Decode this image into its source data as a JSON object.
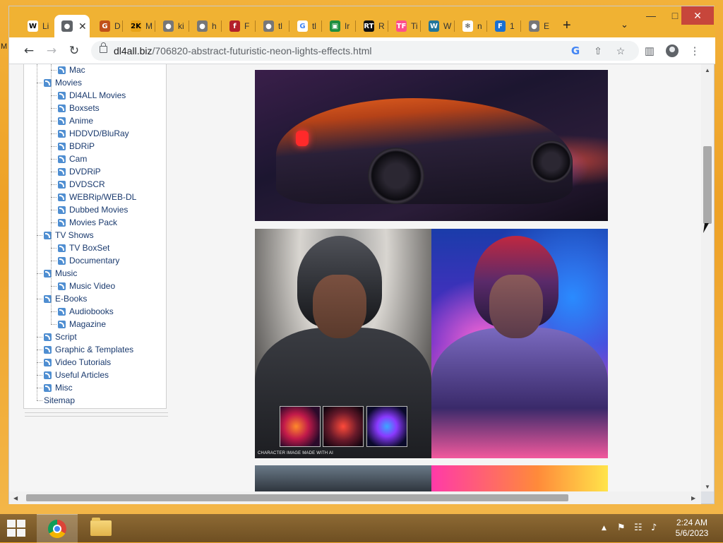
{
  "window": {
    "tabs": [
      {
        "icon": "wikipedia-icon",
        "glyph": "W",
        "color": "#ffffff",
        "fg": "#000000",
        "title": "Li"
      },
      {
        "icon": "globe-icon",
        "glyph": "●",
        "color": "#5f6368",
        "fg": "#ffffff",
        "title": "",
        "active": true
      },
      {
        "icon": "g-square-icon",
        "glyph": "G",
        "color": "#c0501a",
        "fg": "#ffffff",
        "title": "D"
      },
      {
        "icon": "2k-icon",
        "glyph": "2K",
        "color": "#e8a317",
        "fg": "#000000",
        "title": "M"
      },
      {
        "icon": "globe-icon",
        "glyph": "●",
        "color": "#777777",
        "fg": "#ffffff",
        "title": "ki"
      },
      {
        "icon": "globe-icon",
        "glyph": "●",
        "color": "#777777",
        "fg": "#ffffff",
        "title": "h"
      },
      {
        "icon": "f-red-icon",
        "glyph": "f",
        "color": "#b3202a",
        "fg": "#ffffff",
        "title": "F"
      },
      {
        "icon": "globe-icon",
        "glyph": "●",
        "color": "#777777",
        "fg": "#ffffff",
        "title": "tl"
      },
      {
        "icon": "google-icon",
        "glyph": "G",
        "color": "#ffffff",
        "fg": "#4285f4",
        "title": "tl"
      },
      {
        "icon": "image-search-icon",
        "glyph": "▣",
        "color": "#1e8e3e",
        "fg": "#ffffff",
        "title": "Ir"
      },
      {
        "icon": "rt-icon",
        "glyph": "RT",
        "color": "#111111",
        "fg": "#ffffff",
        "title": "R"
      },
      {
        "icon": "tf-icon",
        "glyph": "TF",
        "color": "#ff4f8b",
        "fg": "#ffffff",
        "title": "Ti"
      },
      {
        "icon": "wordpress-icon",
        "glyph": "W",
        "color": "#21759b",
        "fg": "#ffffff",
        "title": "W"
      },
      {
        "icon": "snowflake-icon",
        "glyph": "❄",
        "color": "#ffffff",
        "fg": "#444444",
        "title": "n"
      },
      {
        "icon": "f-blue-icon",
        "glyph": "F",
        "color": "#1a6fd1",
        "fg": "#ffffff",
        "title": "1"
      },
      {
        "icon": "globe-icon",
        "glyph": "●",
        "color": "#777777",
        "fg": "#ffffff",
        "title": "E"
      }
    ],
    "new_tab": "+",
    "tab_list": "⌄",
    "controls": {
      "minimize": "—",
      "maximize": "□",
      "close": "✕"
    }
  },
  "toolbar": {
    "back": "←",
    "forward": "→",
    "reload": "↻",
    "url_host": "dl4all.biz",
    "url_path": "/706820-abstract-futuristic-neon-lights-effects.html",
    "google_lens": "G",
    "share": "⇧",
    "bookmark": "☆",
    "side_panel": "▥",
    "menu": "⋮"
  },
  "sidebar": {
    "items": [
      {
        "label": "Mac",
        "level": 2
      },
      {
        "label": "Movies",
        "level": 1
      },
      {
        "label": "Dl4ALL Movies",
        "level": 2
      },
      {
        "label": "Boxsets",
        "level": 2
      },
      {
        "label": "Anime",
        "level": 2
      },
      {
        "label": "HDDVD/BluRay",
        "level": 2
      },
      {
        "label": "BDRiP",
        "level": 2
      },
      {
        "label": "Cam",
        "level": 2
      },
      {
        "label": "DVDRiP",
        "level": 2
      },
      {
        "label": "DVDSCR",
        "level": 2
      },
      {
        "label": "WEBRip/WEB-DL",
        "level": 2
      },
      {
        "label": "Dubbed Movies",
        "level": 2
      },
      {
        "label": "Movies Pack",
        "level": 2
      },
      {
        "label": "TV Shows",
        "level": 1
      },
      {
        "label": "TV BoxSet",
        "level": 2
      },
      {
        "label": "Documentary",
        "level": 2
      },
      {
        "label": "Music",
        "level": 1
      },
      {
        "label": "Music Video",
        "level": 2
      },
      {
        "label": "E-Books",
        "level": 1
      },
      {
        "label": "Audiobooks",
        "level": 2
      },
      {
        "label": "Magazine",
        "level": 2
      },
      {
        "label": "Script",
        "level": 1
      },
      {
        "label": "Graphic & Templates",
        "level": 1
      },
      {
        "label": "Video Tutorials",
        "level": 1
      },
      {
        "label": "Useful Articles",
        "level": 1
      },
      {
        "label": "Misc",
        "level": 1
      },
      {
        "label": "Sitemap",
        "level": 0
      }
    ]
  },
  "content": {
    "image_caption": "CHARACTER IMAGE MADE WITH AI"
  },
  "taskbar": {
    "time": "2:24 AM",
    "date": "5/6/2023",
    "tray_up": "▲",
    "flag": "⚑",
    "network": "☷",
    "volume": "♪"
  },
  "desktop": {
    "icon_label": "M"
  }
}
